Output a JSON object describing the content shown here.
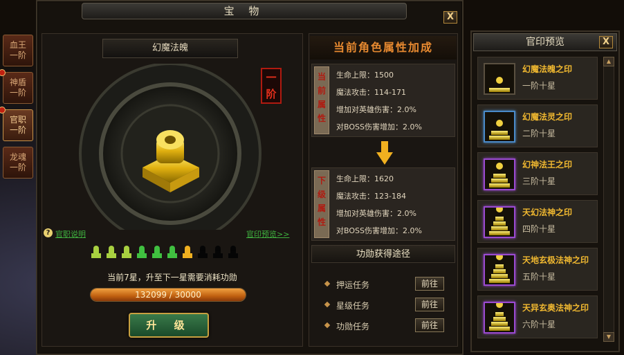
{
  "main": {
    "title": "宝 物",
    "close_label": "X",
    "tabs": [
      {
        "label_line1": "血王",
        "label_line2": "一阶",
        "alert": false
      },
      {
        "label_line1": "神盾",
        "label_line2": "一阶",
        "alert": true
      },
      {
        "label_line1": "官职",
        "label_line2": "一阶",
        "alert": true,
        "active": true
      },
      {
        "label_line1": "龙魂",
        "label_line2": "一阶",
        "alert": false
      }
    ],
    "item_name": "幻魔法魄",
    "tier_badge": "一\n阶",
    "help_link": "官职说明",
    "help_icon": "?",
    "preview_link": "官印预览>>",
    "stars": {
      "current": 7,
      "total": 10
    },
    "upgrade_info": "当前7星，升至下一星需要消耗功勋",
    "progress": {
      "text": "132099 / 30000",
      "fill_fraction": 1.0
    },
    "upgrade_button": "升 级"
  },
  "attributes": {
    "title": "当前角色属性加成",
    "current": {
      "label": "当前属性",
      "lines": [
        "生命上限：1500",
        "魔法攻击：114-171",
        "增加对英雄伤害：2.0%",
        "对BOSS伤害增加：2.0%"
      ]
    },
    "next": {
      "label": "下级属性",
      "lines": [
        "生命上限：1620",
        "魔法攻击：123-184",
        "增加对英雄伤害：2.0%",
        "对BOSS伤害增加：2.0%"
      ]
    },
    "merit_title": "功勋获得途径",
    "merit_sources": [
      {
        "label": "押运任务",
        "button": "前往"
      },
      {
        "label": "星级任务",
        "button": "前往"
      },
      {
        "label": "功勋任务",
        "button": "前往"
      }
    ]
  },
  "preview": {
    "title": "官印预览",
    "close_label": "X",
    "seals": [
      {
        "name": "幻魔法魄之印",
        "tier": "一阶十星",
        "frame": "plain"
      },
      {
        "name": "幻魔法灵之印",
        "tier": "二阶十星",
        "frame": "blue"
      },
      {
        "name": "幻神法王之印",
        "tier": "三阶十星",
        "frame": "purple"
      },
      {
        "name": "天幻法神之印",
        "tier": "四阶十星",
        "frame": "purple"
      },
      {
        "name": "天地玄极法神之印",
        "tier": "五阶十星",
        "frame": "purple"
      },
      {
        "name": "天异玄奥法神之印",
        "tier": "六阶十星",
        "frame": "purple"
      }
    ]
  },
  "colors": {
    "accent_gold": "#f0b830",
    "link_green": "#3fb23f",
    "badge_red": "#b01a10"
  }
}
